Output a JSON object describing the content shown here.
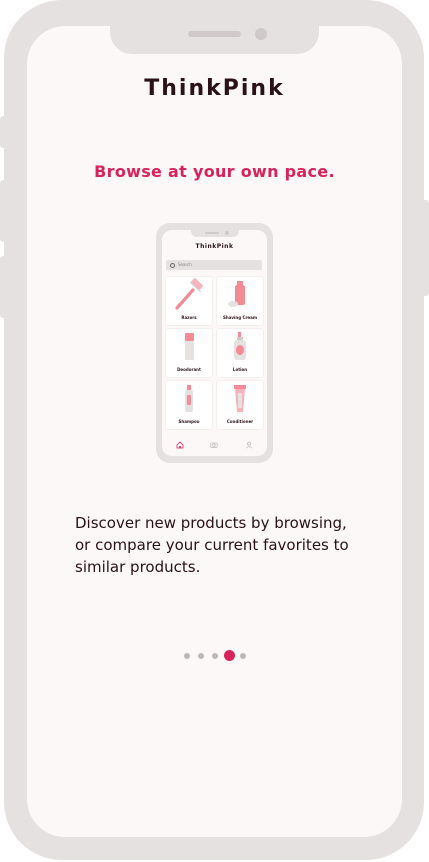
{
  "app": {
    "title": "ThinkPink"
  },
  "onboarding": {
    "heading": "Browse at your own pace.",
    "description_lines": [
      "Discover new products by browsing,",
      "or compare your current favorites to",
      "similar products."
    ],
    "pagination": {
      "total": 5,
      "current": 4
    }
  },
  "preview": {
    "title": "ThinkPink",
    "search_placeholder": "Search",
    "categories": [
      {
        "label": "Razors",
        "icon": "razor-icon"
      },
      {
        "label": "Shaving Cream",
        "icon": "shaving-cream-icon"
      },
      {
        "label": "Deodorant",
        "icon": "deodorant-icon"
      },
      {
        "label": "Lotion",
        "icon": "lotion-icon"
      },
      {
        "label": "Shampoo",
        "icon": "shampoo-icon"
      },
      {
        "label": "Conditioner",
        "icon": "conditioner-icon"
      }
    ],
    "nav": [
      "home-icon",
      "camera-icon",
      "profile-icon"
    ]
  },
  "colors": {
    "accent": "#d8235a",
    "product_pink": "#f28b95",
    "frame": "#e6e1e1",
    "text": "#2a1216"
  }
}
